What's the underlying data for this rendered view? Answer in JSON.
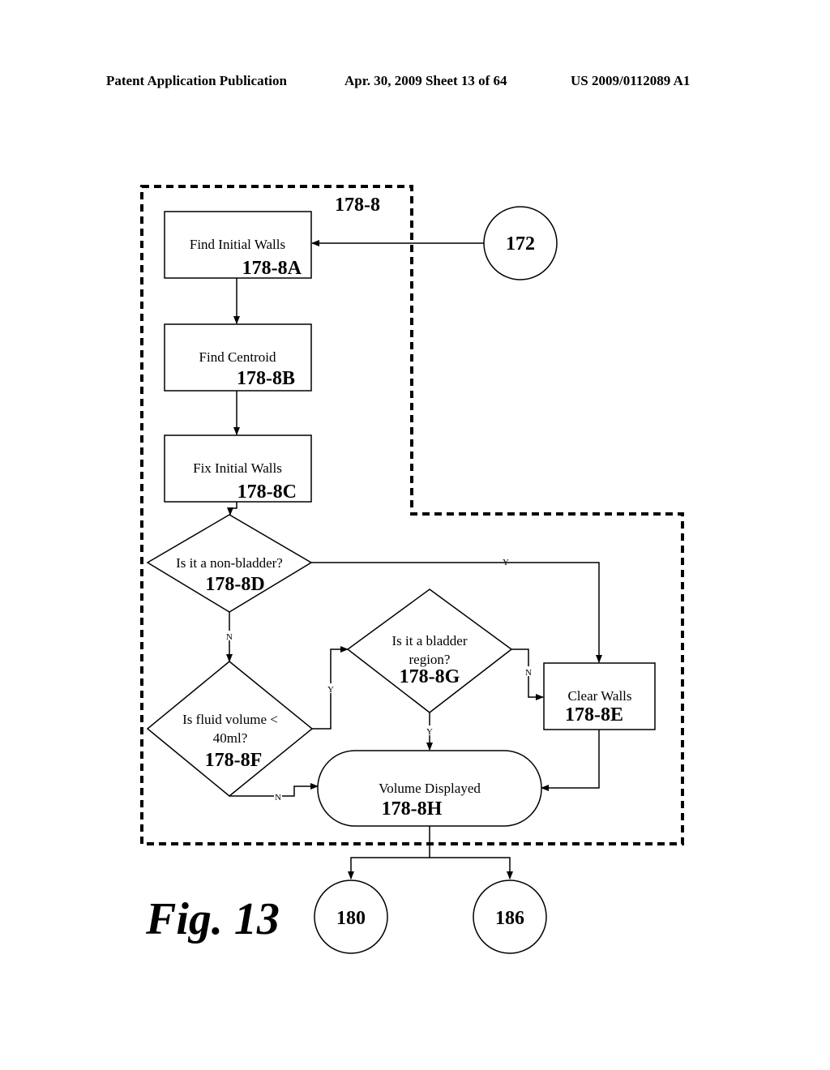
{
  "header": {
    "publication": "Patent Application Publication",
    "date_sheet": "Apr. 30, 2009  Sheet 13 of 64",
    "number": "US 2009/0112089 A1"
  },
  "figure": {
    "label": "Fig. 13",
    "group_ref": "178-8"
  },
  "nodes": {
    "n172": {
      "ref": "172"
    },
    "a": {
      "text": "Find Initial Walls",
      "ref": "178-8A"
    },
    "b": {
      "text": "Find Centroid",
      "ref": "178-8B"
    },
    "c": {
      "text": "Fix Initial Walls",
      "ref": "178-8C"
    },
    "d": {
      "text": "Is it a non-bladder?",
      "ref": "178-8D"
    },
    "f": {
      "text_line1": "Is fluid volume <",
      "text_line2": "40ml?",
      "ref": "178-8F"
    },
    "g": {
      "text_line1": "Is it a bladder",
      "text_line2": "region?",
      "ref": "178-8G"
    },
    "e": {
      "text": "Clear Walls",
      "ref": "178-8E"
    },
    "h": {
      "text": "Volume Displayed",
      "ref": "178-8H"
    },
    "n180": {
      "ref": "180"
    },
    "n186": {
      "ref": "186"
    }
  },
  "edge_labels": {
    "d_yes": "Y",
    "d_no": "N",
    "f_yes": "Y",
    "f_no": "N",
    "g_yes": "Y",
    "g_no": "N"
  }
}
